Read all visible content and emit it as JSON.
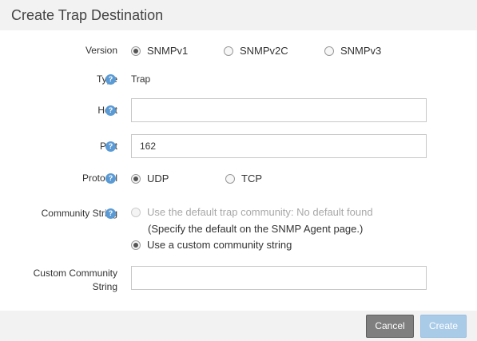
{
  "dialog": {
    "title": "Create Trap Destination"
  },
  "version": {
    "label": "Version",
    "options": [
      "SNMPv1",
      "SNMPv2C",
      "SNMPv3"
    ],
    "selected": "SNMPv1"
  },
  "type": {
    "label": "Type",
    "value": "Trap"
  },
  "host": {
    "label": "Host",
    "value": ""
  },
  "port": {
    "label": "Port",
    "value": "162"
  },
  "protocol": {
    "label": "Protocol",
    "options": [
      "UDP",
      "TCP"
    ],
    "selected": "UDP"
  },
  "community_string": {
    "label": "Community String",
    "default_option": "Use the default trap community: No default found",
    "default_hint": "(Specify the default on the SNMP Agent page.)",
    "custom_option": "Use a custom community string",
    "selected": "custom"
  },
  "custom_community": {
    "label_line1": "Custom Community",
    "label_line2": "String",
    "value": ""
  },
  "footer": {
    "cancel_label": "Cancel",
    "create_label": "Create"
  },
  "colors": {
    "help_icon": "#5b9bd5",
    "cancel_bg": "#7f7f7f",
    "create_bg_disabled": "#a9cbe8",
    "header_bg": "#f2f2f2"
  },
  "icons": {
    "help": "question-circle-icon"
  }
}
